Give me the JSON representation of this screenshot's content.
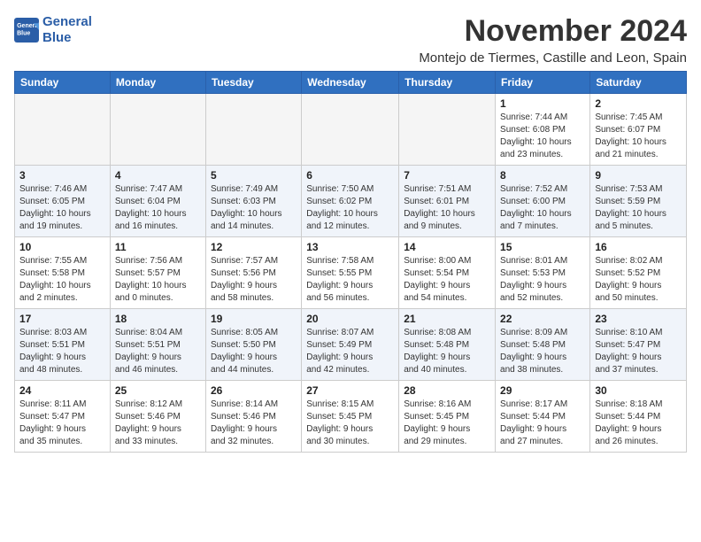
{
  "logo": {
    "line1": "General",
    "line2": "Blue"
  },
  "title": "November 2024",
  "location": "Montejo de Tiermes, Castille and Leon, Spain",
  "weekdays": [
    "Sunday",
    "Monday",
    "Tuesday",
    "Wednesday",
    "Thursday",
    "Friday",
    "Saturday"
  ],
  "weeks": [
    [
      {
        "day": "",
        "info": ""
      },
      {
        "day": "",
        "info": ""
      },
      {
        "day": "",
        "info": ""
      },
      {
        "day": "",
        "info": ""
      },
      {
        "day": "",
        "info": ""
      },
      {
        "day": "1",
        "info": "Sunrise: 7:44 AM\nSunset: 6:08 PM\nDaylight: 10 hours\nand 23 minutes."
      },
      {
        "day": "2",
        "info": "Sunrise: 7:45 AM\nSunset: 6:07 PM\nDaylight: 10 hours\nand 21 minutes."
      }
    ],
    [
      {
        "day": "3",
        "info": "Sunrise: 7:46 AM\nSunset: 6:05 PM\nDaylight: 10 hours\nand 19 minutes."
      },
      {
        "day": "4",
        "info": "Sunrise: 7:47 AM\nSunset: 6:04 PM\nDaylight: 10 hours\nand 16 minutes."
      },
      {
        "day": "5",
        "info": "Sunrise: 7:49 AM\nSunset: 6:03 PM\nDaylight: 10 hours\nand 14 minutes."
      },
      {
        "day": "6",
        "info": "Sunrise: 7:50 AM\nSunset: 6:02 PM\nDaylight: 10 hours\nand 12 minutes."
      },
      {
        "day": "7",
        "info": "Sunrise: 7:51 AM\nSunset: 6:01 PM\nDaylight: 10 hours\nand 9 minutes."
      },
      {
        "day": "8",
        "info": "Sunrise: 7:52 AM\nSunset: 6:00 PM\nDaylight: 10 hours\nand 7 minutes."
      },
      {
        "day": "9",
        "info": "Sunrise: 7:53 AM\nSunset: 5:59 PM\nDaylight: 10 hours\nand 5 minutes."
      }
    ],
    [
      {
        "day": "10",
        "info": "Sunrise: 7:55 AM\nSunset: 5:58 PM\nDaylight: 10 hours\nand 2 minutes."
      },
      {
        "day": "11",
        "info": "Sunrise: 7:56 AM\nSunset: 5:57 PM\nDaylight: 10 hours\nand 0 minutes."
      },
      {
        "day": "12",
        "info": "Sunrise: 7:57 AM\nSunset: 5:56 PM\nDaylight: 9 hours\nand 58 minutes."
      },
      {
        "day": "13",
        "info": "Sunrise: 7:58 AM\nSunset: 5:55 PM\nDaylight: 9 hours\nand 56 minutes."
      },
      {
        "day": "14",
        "info": "Sunrise: 8:00 AM\nSunset: 5:54 PM\nDaylight: 9 hours\nand 54 minutes."
      },
      {
        "day": "15",
        "info": "Sunrise: 8:01 AM\nSunset: 5:53 PM\nDaylight: 9 hours\nand 52 minutes."
      },
      {
        "day": "16",
        "info": "Sunrise: 8:02 AM\nSunset: 5:52 PM\nDaylight: 9 hours\nand 50 minutes."
      }
    ],
    [
      {
        "day": "17",
        "info": "Sunrise: 8:03 AM\nSunset: 5:51 PM\nDaylight: 9 hours\nand 48 minutes."
      },
      {
        "day": "18",
        "info": "Sunrise: 8:04 AM\nSunset: 5:51 PM\nDaylight: 9 hours\nand 46 minutes."
      },
      {
        "day": "19",
        "info": "Sunrise: 8:05 AM\nSunset: 5:50 PM\nDaylight: 9 hours\nand 44 minutes."
      },
      {
        "day": "20",
        "info": "Sunrise: 8:07 AM\nSunset: 5:49 PM\nDaylight: 9 hours\nand 42 minutes."
      },
      {
        "day": "21",
        "info": "Sunrise: 8:08 AM\nSunset: 5:48 PM\nDaylight: 9 hours\nand 40 minutes."
      },
      {
        "day": "22",
        "info": "Sunrise: 8:09 AM\nSunset: 5:48 PM\nDaylight: 9 hours\nand 38 minutes."
      },
      {
        "day": "23",
        "info": "Sunrise: 8:10 AM\nSunset: 5:47 PM\nDaylight: 9 hours\nand 37 minutes."
      }
    ],
    [
      {
        "day": "24",
        "info": "Sunrise: 8:11 AM\nSunset: 5:47 PM\nDaylight: 9 hours\nand 35 minutes."
      },
      {
        "day": "25",
        "info": "Sunrise: 8:12 AM\nSunset: 5:46 PM\nDaylight: 9 hours\nand 33 minutes."
      },
      {
        "day": "26",
        "info": "Sunrise: 8:14 AM\nSunset: 5:46 PM\nDaylight: 9 hours\nand 32 minutes."
      },
      {
        "day": "27",
        "info": "Sunrise: 8:15 AM\nSunset: 5:45 PM\nDaylight: 9 hours\nand 30 minutes."
      },
      {
        "day": "28",
        "info": "Sunrise: 8:16 AM\nSunset: 5:45 PM\nDaylight: 9 hours\nand 29 minutes."
      },
      {
        "day": "29",
        "info": "Sunrise: 8:17 AM\nSunset: 5:44 PM\nDaylight: 9 hours\nand 27 minutes."
      },
      {
        "day": "30",
        "info": "Sunrise: 8:18 AM\nSunset: 5:44 PM\nDaylight: 9 hours\nand 26 minutes."
      }
    ]
  ]
}
